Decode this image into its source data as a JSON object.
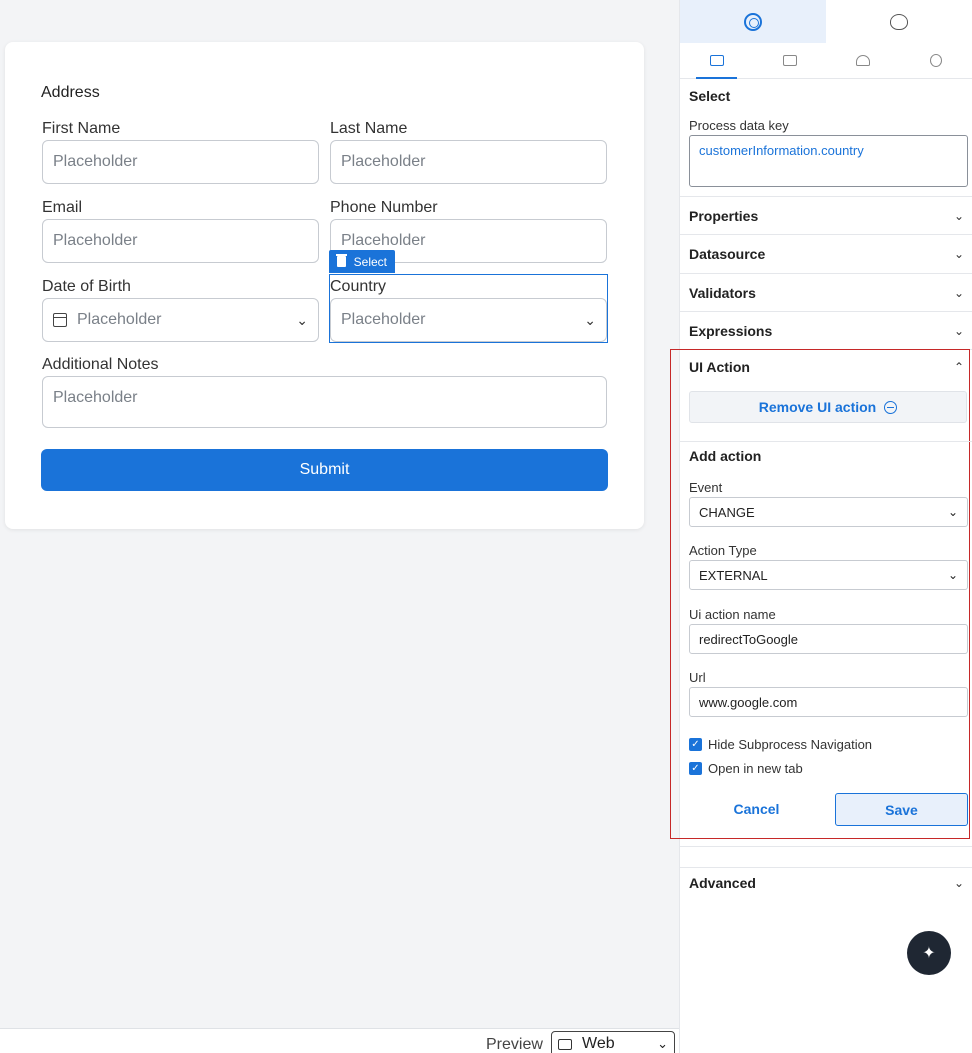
{
  "form": {
    "title": "Address",
    "fields": {
      "first_name": {
        "label": "First Name",
        "placeholder": "Placeholder"
      },
      "last_name": {
        "label": "Last Name",
        "placeholder": "Placeholder"
      },
      "email": {
        "label": "Email",
        "placeholder": "Placeholder"
      },
      "phone": {
        "label": "Phone Number",
        "placeholder": "Placeholder"
      },
      "dob": {
        "label": "Date of Birth",
        "placeholder": "Placeholder"
      },
      "country": {
        "label": "Country",
        "placeholder": "Placeholder"
      },
      "notes": {
        "label": "Additional Notes",
        "placeholder": "Placeholder"
      }
    },
    "selection_tag": "Select",
    "submit_label": "Submit"
  },
  "preview": {
    "label": "Preview",
    "selected": "Web"
  },
  "panel": {
    "component_type": "Select",
    "process_data_key": {
      "label": "Process data key",
      "value": "customerInformation.country"
    },
    "sections": {
      "properties": "Properties",
      "datasource": "Datasource",
      "validators": "Validators",
      "expressions": "Expressions",
      "ui_action": "UI Action",
      "advanced": "Advanced"
    },
    "ui_action": {
      "remove_label": "Remove UI action",
      "add_action_title": "Add action",
      "event": {
        "label": "Event",
        "value": "CHANGE"
      },
      "action_type": {
        "label": "Action Type",
        "value": "EXTERNAL"
      },
      "ui_action_name": {
        "label": "Ui action name",
        "value": "redirectToGoogle"
      },
      "url": {
        "label": "Url",
        "value": "www.google.com"
      },
      "hide_subprocess_navigation": {
        "label": "Hide Subprocess Navigation",
        "checked": true
      },
      "open_in_new_tab": {
        "label": "Open in new tab",
        "checked": true
      },
      "cancel_label": "Cancel",
      "save_label": "Save"
    }
  },
  "colors": {
    "accent": "#1a73d9",
    "highlight_border": "#c62828"
  }
}
